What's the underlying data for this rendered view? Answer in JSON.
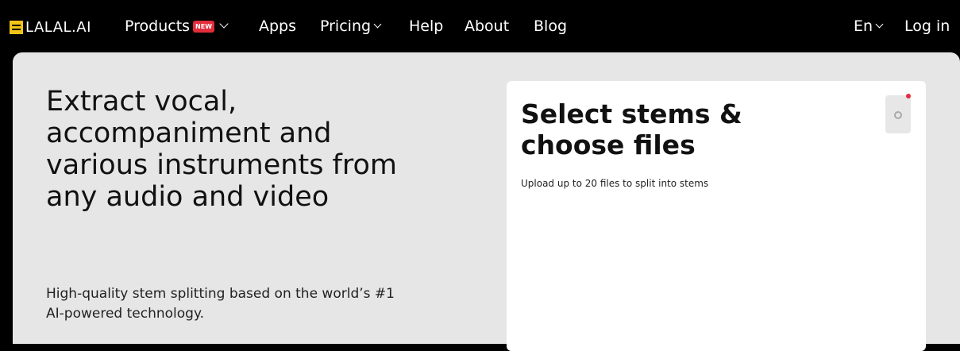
{
  "nav": {
    "logo_text": "LALAL.AI",
    "products": "Products",
    "products_badge": "NEW",
    "apps": "Apps",
    "pricing": "Pricing",
    "help": "Help",
    "about": "About",
    "blog": "Blog",
    "language": "En",
    "login": "Log in"
  },
  "hero": {
    "title": "Extract vocal, accompaniment and various instruments from any audio and video",
    "subtitle": "High-quality stem splitting based on the world’s #1 AI-powered technology."
  },
  "card": {
    "title": "Select stems & choose files",
    "subtitle": "Upload up to 20 files to split into stems",
    "settings_icon": "settings-icon",
    "notification_color": "#e32d3a"
  },
  "colors": {
    "nav_bg": "#000000",
    "panel_bg": "#e6e6e6",
    "brand_yellow": "#f2c318",
    "badge_red": "#e32d3a"
  }
}
